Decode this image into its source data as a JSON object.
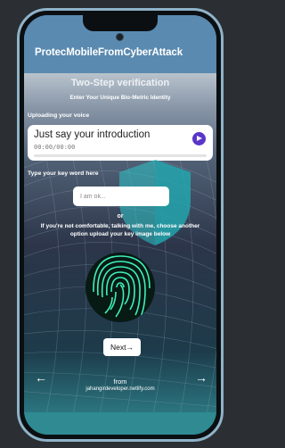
{
  "app": {
    "title": "ProtecMobileFromCyberAttack"
  },
  "verification": {
    "heading": "Two-Step verification",
    "subtitle": "Enter Your Unique Bio-Metric Identity"
  },
  "voice": {
    "label": "Uploading your voice",
    "audio_title": "Just say your introduction",
    "audio_time": "00:00/00:00"
  },
  "keyword": {
    "label": "Type your key word here",
    "placeholder": "I am ok..."
  },
  "alternate": {
    "or": "or",
    "instruction": "If you're not comfortable, talking with me, choose another option upload your key image below"
  },
  "buttons": {
    "next": "Next→",
    "prev_arrow": "←",
    "next_arrow": "→"
  },
  "footer": {
    "from": "from",
    "url": "jahangirdeveloper.netlify.com"
  },
  "colors": {
    "accent": "#5a35c8",
    "header": "#5a8ab0",
    "teal": "#2f8a92"
  }
}
